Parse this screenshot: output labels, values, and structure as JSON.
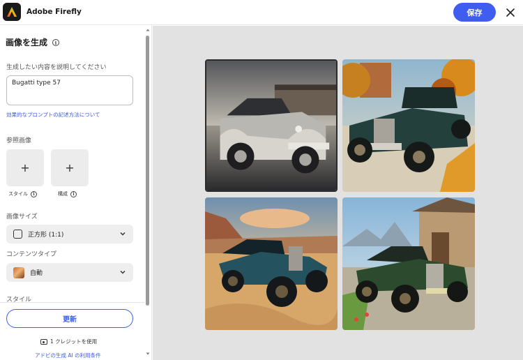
{
  "header": {
    "app_title": "Adobe Firefly",
    "save_label": "保存"
  },
  "sidebar": {
    "title": "画像を生成",
    "prompt_label": "生成したい内容を説明してください",
    "prompt_value": "Bugatti type 57",
    "prompt_help_link": "効果的なプロンプトの記述方法について",
    "reference_label": "参照画像",
    "style_label": "スタイル",
    "composition_label": "構成",
    "image_size_label": "画像サイズ",
    "image_size_value": "正方形 (1:1)",
    "content_type_label": "コンテンツタイプ",
    "content_type_value": "自動",
    "style_section_label": "スタイル",
    "update_label": "更新",
    "credit_text": "1 クレジットを使用",
    "terms_link": "アドビの生成 AI の利用条件"
  },
  "images": [
    {
      "name": "car-image-1",
      "selected": true
    },
    {
      "name": "car-image-2",
      "selected": false
    },
    {
      "name": "car-image-3",
      "selected": false
    },
    {
      "name": "car-image-4",
      "selected": false
    }
  ],
  "colors": {
    "accent": "#3f5ef0",
    "canvas_bg": "#e2e2e2"
  }
}
